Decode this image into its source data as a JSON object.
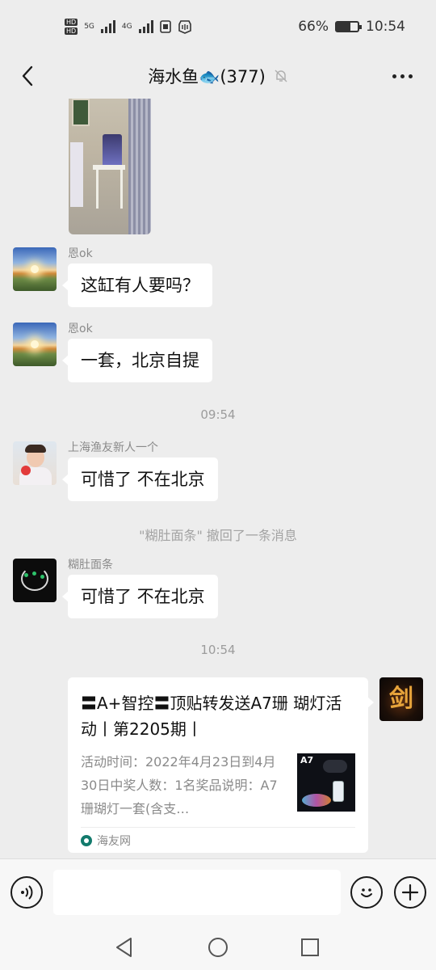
{
  "status_bar": {
    "network_labels": [
      "HD",
      "HD",
      "5G",
      "4G"
    ],
    "battery_percent": "66%",
    "battery_level": 0.66,
    "time": "10:54"
  },
  "header": {
    "title": "海水鱼🐟(377)",
    "icons": {
      "back": "back-arrow-icon",
      "mute": "bell-muted-icon",
      "more": "more-icon"
    }
  },
  "messages": [
    {
      "sender": "恩ok",
      "text": "这缸有人要吗？",
      "avatar": "sunset-landscape"
    },
    {
      "sender": "恩ok",
      "text": "一套，北京自提",
      "avatar": "sunset-landscape"
    },
    {
      "timestamp": "09:54"
    },
    {
      "sender": "上海渔友新人一个",
      "text": "可惜了 不在北京",
      "avatar": "child-photo"
    },
    {
      "system": "\"糊肚面条\" 撤回了一条消息"
    },
    {
      "sender": "糊肚面条",
      "text": "可惜了 不在北京",
      "avatar": "dark-art"
    },
    {
      "timestamp": "10:54"
    }
  ],
  "link_card": {
    "title": "〓A+智控〓顶贴转发送A7珊 瑚灯活动丨第2205期丨",
    "description": "活动时间：2022年4月23日到4月30日中奖人数：1名奖品说明：A7珊瑚灯一套(含支…",
    "thumb_label": "A7",
    "source": "海友网",
    "sender_avatar": "sword-glyph",
    "sender_avatar_glyph": "剑"
  },
  "input_bar": {
    "value": "",
    "placeholder": "",
    "icons": {
      "voice": "voice-icon",
      "emoji": "emoji-icon",
      "plus": "plus-icon"
    }
  },
  "system_nav": {
    "icons": [
      "back-triangle-icon",
      "home-circle-icon",
      "recents-square-icon"
    ]
  },
  "colors": {
    "background": "#ededed",
    "bubble": "#ffffff",
    "muted_text": "#8a8a8a"
  }
}
